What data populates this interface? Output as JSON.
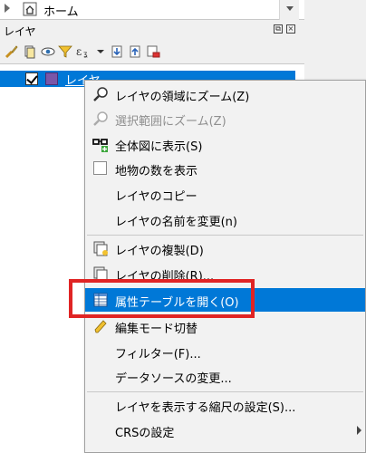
{
  "browser": {
    "home_label": "ホーム"
  },
  "layers_panel": {
    "title": "レイヤ",
    "float_btn": "⧉",
    "close_btn": "×",
    "layer": {
      "name": "レイヤ",
      "checked": true,
      "swatch_color": "#7a56a8"
    }
  },
  "context_menu": {
    "items": [
      {
        "label": "レイヤの領域にズーム(Z)",
        "icon": "zoom-magnifier-icon",
        "enabled": true
      },
      {
        "label": "選択範囲にズーム(Z)",
        "icon": "zoom-selection-icon",
        "enabled": false
      },
      {
        "label": "全体図に表示(S)",
        "icon": "overview-glasses-icon",
        "enabled": true
      },
      {
        "label": "地物の数を表示",
        "icon": "checkbox",
        "enabled": true
      },
      {
        "label": "レイヤのコピー",
        "icon": "",
        "enabled": true
      },
      {
        "label": "レイヤの名前を変更(n)",
        "icon": "",
        "enabled": true
      },
      {
        "label": "レイヤの複製(D)",
        "icon": "duplicate-layer-icon",
        "enabled": true
      },
      {
        "label": "レイヤの削除(R)...",
        "icon": "remove-layer-icon",
        "enabled": true
      },
      {
        "label": "属性テーブルを開く(O)",
        "icon": "attribute-table-icon",
        "enabled": true,
        "highlighted": true
      },
      {
        "label": "編集モード切替",
        "icon": "pencil-icon",
        "enabled": true
      },
      {
        "label": "フィルター(F)...",
        "icon": "",
        "enabled": true
      },
      {
        "label": "データソースの変更...",
        "icon": "",
        "enabled": true
      },
      {
        "label": "レイヤを表示する縮尺の設定(S)...",
        "icon": "",
        "enabled": true
      },
      {
        "label": "CRSの設定",
        "icon": "",
        "enabled": true,
        "submenu": true
      }
    ]
  },
  "colors": {
    "highlight": "#0078d7",
    "annotation_red": "#e02424"
  }
}
